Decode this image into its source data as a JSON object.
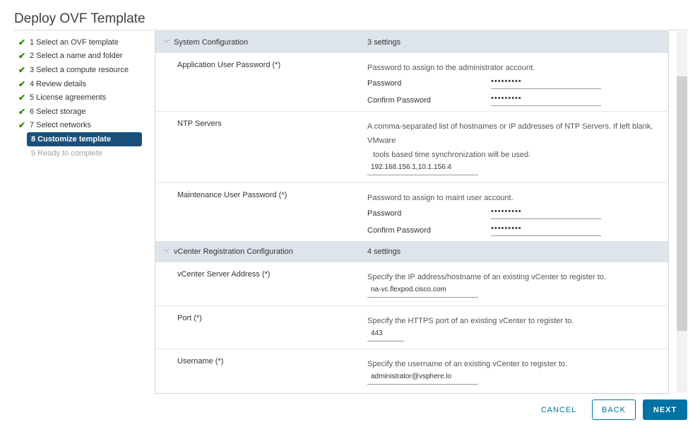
{
  "window": {
    "title": "Deploy OVF Template"
  },
  "steps": [
    {
      "label": "1 Select an OVF template",
      "status": "done"
    },
    {
      "label": "2 Select a name and folder",
      "status": "done"
    },
    {
      "label": "3 Select a compute resource",
      "status": "done"
    },
    {
      "label": "4 Review details",
      "status": "done"
    },
    {
      "label": "5 License agreements",
      "status": "done"
    },
    {
      "label": "6 Select storage",
      "status": "done"
    },
    {
      "label": "7 Select networks",
      "status": "done"
    },
    {
      "label": "8 Customize template",
      "status": "active"
    },
    {
      "label": "9 Ready to complete",
      "status": "disabled"
    }
  ],
  "icons": {
    "step_done": "check-icon",
    "section_toggle": "chevron-down-icon"
  },
  "sections": [
    {
      "title": "System Configuration",
      "count": "3 settings",
      "rows": {
        "app_pw": {
          "label": "Application User Password (*)",
          "desc": "Password to assign to the administrator account.",
          "password_label": "Password",
          "password_value": "•••••••••",
          "confirm_label": "Confirm Password",
          "confirm_value": "•••••••••"
        },
        "ntp": {
          "label": "NTP Servers",
          "desc_line1": "A comma-separated list of hostnames or IP addresses of NTP Servers. If left blank, VMware",
          "desc_line2": "tools based time synchronization will be used.",
          "value": "192.168.156.1,10.1.156.4"
        },
        "maint_pw": {
          "label": "Maintenance User Password (*)",
          "desc": "Password to assign to maint user account.",
          "password_label": "Password",
          "password_value": "•••••••••",
          "confirm_label": "Confirm Password",
          "confirm_value": "•••••••••"
        }
      }
    },
    {
      "title": "vCenter Registration Configuration",
      "count": "4 settings",
      "rows": {
        "vc_addr": {
          "label": "vCenter Server Address (*)",
          "desc": "Specify the IP address/hostname of an existing vCenter to register to.",
          "value": "na-vc.flexpod.cisco.com"
        },
        "port": {
          "label": "Port (*)",
          "desc": "Specify the HTTPS port of an existing vCenter to register to.",
          "value": "443"
        },
        "username": {
          "label": "Username (*)",
          "desc": "Specify the username of an existing vCenter to register to.",
          "value": "administrator@vsphere.lo"
        }
      }
    }
  ],
  "footer": {
    "cancel": "CANCEL",
    "back": "BACK",
    "next": "NEXT"
  },
  "colors": {
    "accent": "#0072a3",
    "active_step": "#1b4f7a",
    "check": "#318700",
    "section_header": "#dde4eb"
  }
}
